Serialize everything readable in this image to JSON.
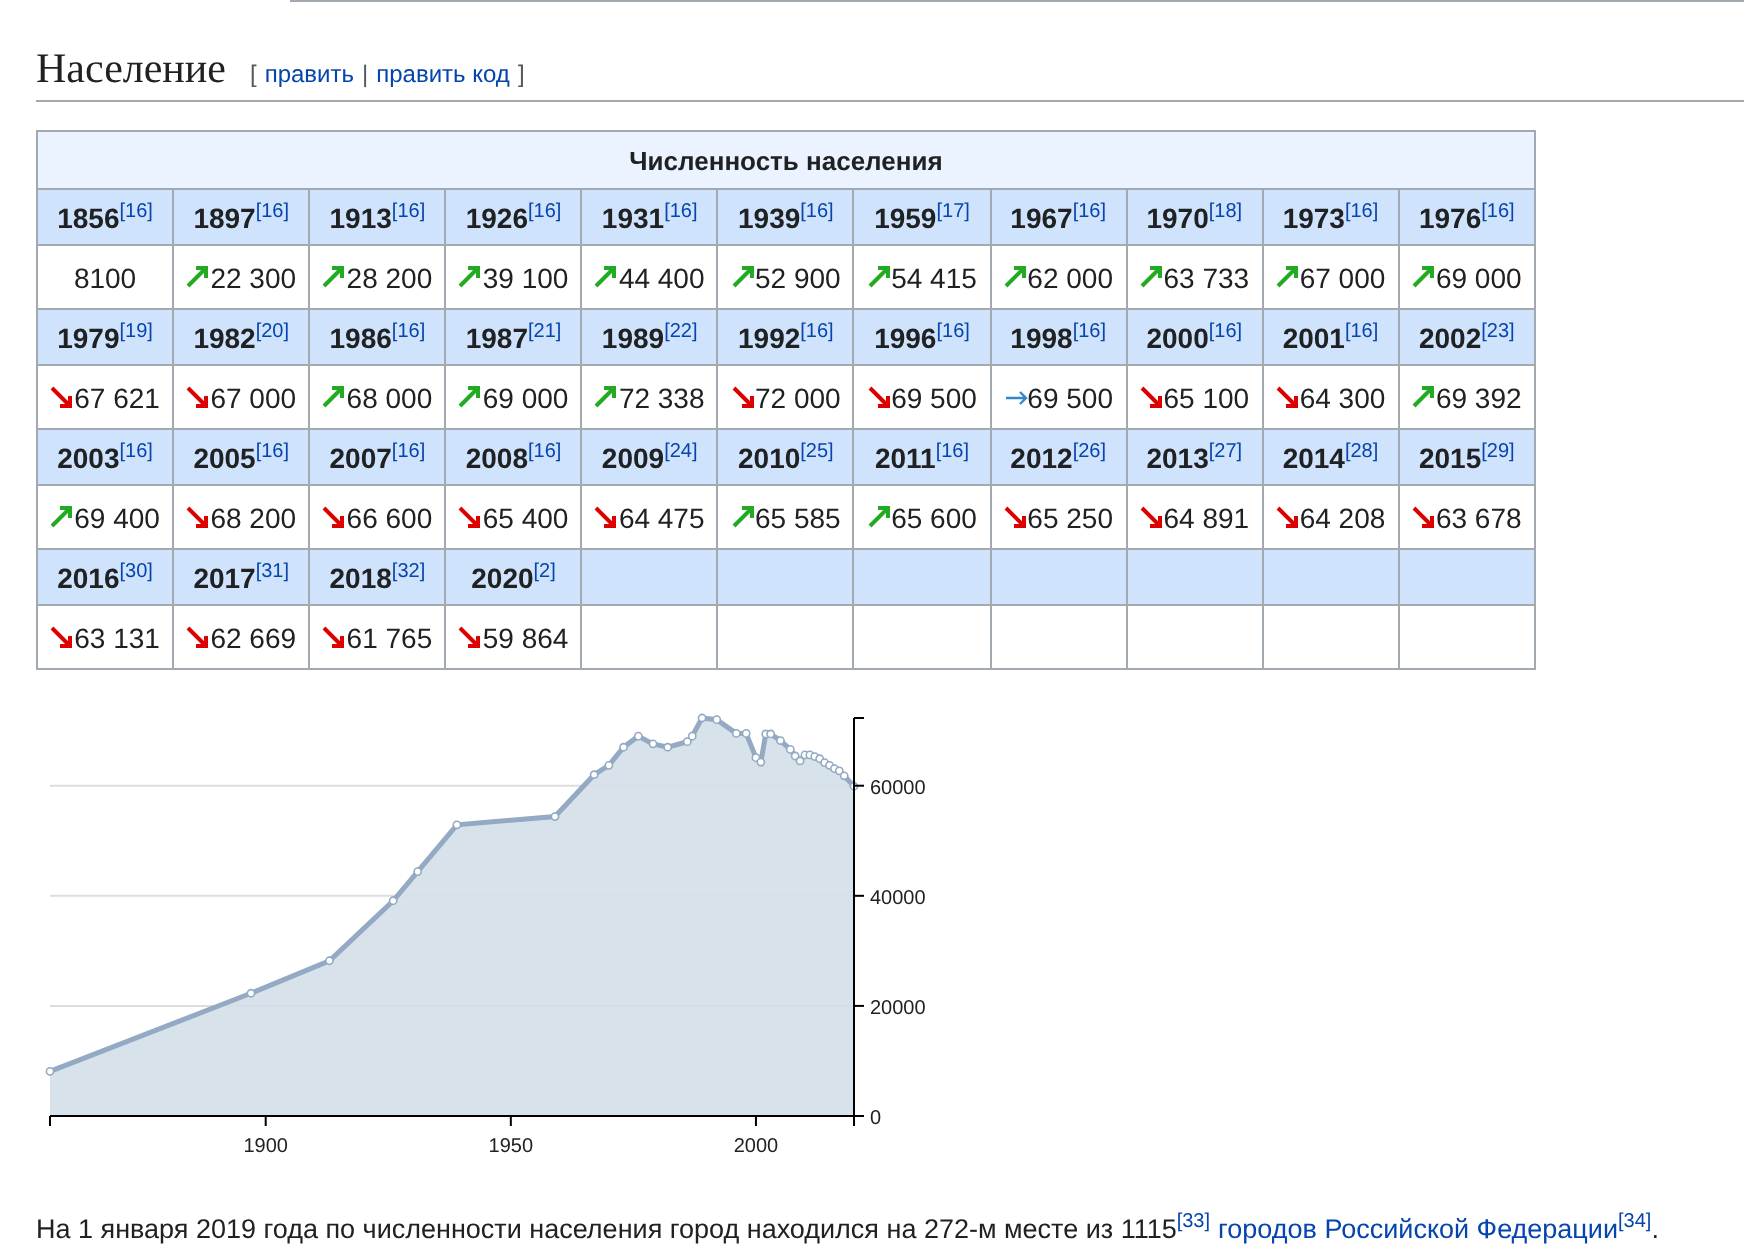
{
  "section": {
    "title": "Население",
    "edit_open": "[",
    "edit_links": [
      "править",
      "править код"
    ],
    "edit_separator": "|",
    "edit_close": "]"
  },
  "table": {
    "caption": "Численность населения",
    "rows": [
      {
        "kind": "years",
        "cells": [
          {
            "year": "1856",
            "ref": "[16]"
          },
          {
            "year": "1897",
            "ref": "[16]"
          },
          {
            "year": "1913",
            "ref": "[16]"
          },
          {
            "year": "1926",
            "ref": "[16]"
          },
          {
            "year": "1931",
            "ref": "[16]"
          },
          {
            "year": "1939",
            "ref": "[16]"
          },
          {
            "year": "1959",
            "ref": "[17]"
          },
          {
            "year": "1967",
            "ref": "[16]"
          },
          {
            "year": "1970",
            "ref": "[18]"
          },
          {
            "year": "1973",
            "ref": "[16]"
          },
          {
            "year": "1976",
            "ref": "[16]"
          }
        ]
      },
      {
        "kind": "values",
        "cells": [
          {
            "value": "8100"
          },
          {
            "value": "22 300",
            "kind": "up"
          },
          {
            "value": "28 200",
            "kind": "up"
          },
          {
            "value": "39 100",
            "kind": "up"
          },
          {
            "value": "44 400",
            "kind": "up"
          },
          {
            "value": "52 900",
            "kind": "up"
          },
          {
            "value": "54 415",
            "kind": "up"
          },
          {
            "value": "62 000",
            "kind": "up"
          },
          {
            "value": "63 733",
            "kind": "up"
          },
          {
            "value": "67 000",
            "kind": "up"
          },
          {
            "value": "69 000",
            "kind": "up"
          }
        ]
      },
      {
        "kind": "years",
        "cells": [
          {
            "year": "1979",
            "ref": "[19]"
          },
          {
            "year": "1982",
            "ref": "[20]"
          },
          {
            "year": "1986",
            "ref": "[16]"
          },
          {
            "year": "1987",
            "ref": "[21]"
          },
          {
            "year": "1989",
            "ref": "[22]"
          },
          {
            "year": "1992",
            "ref": "[16]"
          },
          {
            "year": "1996",
            "ref": "[16]"
          },
          {
            "year": "1998",
            "ref": "[16]"
          },
          {
            "year": "2000",
            "ref": "[16]"
          },
          {
            "year": "2001",
            "ref": "[16]"
          },
          {
            "year": "2002",
            "ref": "[23]"
          }
        ]
      },
      {
        "kind": "values",
        "cells": [
          {
            "value": "67 621",
            "kind": "down"
          },
          {
            "value": "67 000",
            "kind": "down"
          },
          {
            "value": "68 000",
            "kind": "up"
          },
          {
            "value": "69 000",
            "kind": "up"
          },
          {
            "value": "72 338",
            "kind": "up"
          },
          {
            "value": "72 000",
            "kind": "down"
          },
          {
            "value": "69 500",
            "kind": "down"
          },
          {
            "value": "69 500",
            "kind": "flat"
          },
          {
            "value": "65 100",
            "kind": "down"
          },
          {
            "value": "64 300",
            "kind": "down"
          },
          {
            "value": "69 392",
            "kind": "up"
          }
        ]
      },
      {
        "kind": "years",
        "cells": [
          {
            "year": "2003",
            "ref": "[16]"
          },
          {
            "year": "2005",
            "ref": "[16]"
          },
          {
            "year": "2007",
            "ref": "[16]"
          },
          {
            "year": "2008",
            "ref": "[16]"
          },
          {
            "year": "2009",
            "ref": "[24]"
          },
          {
            "year": "2010",
            "ref": "[25]"
          },
          {
            "year": "2011",
            "ref": "[16]"
          },
          {
            "year": "2012",
            "ref": "[26]"
          },
          {
            "year": "2013",
            "ref": "[27]"
          },
          {
            "year": "2014",
            "ref": "[28]"
          },
          {
            "year": "2015",
            "ref": "[29]"
          }
        ]
      },
      {
        "kind": "values",
        "cells": [
          {
            "value": "69 400",
            "kind": "up"
          },
          {
            "value": "68 200",
            "kind": "down"
          },
          {
            "value": "66 600",
            "kind": "down"
          },
          {
            "value": "65 400",
            "kind": "down"
          },
          {
            "value": "64 475",
            "kind": "down"
          },
          {
            "value": "65 585",
            "kind": "up"
          },
          {
            "value": "65 600",
            "kind": "up"
          },
          {
            "value": "65 250",
            "kind": "down"
          },
          {
            "value": "64 891",
            "kind": "down"
          },
          {
            "value": "64 208",
            "kind": "down"
          },
          {
            "value": "63 678",
            "kind": "down"
          }
        ]
      },
      {
        "kind": "years",
        "cells": [
          {
            "year": "2016",
            "ref": "[30]"
          },
          {
            "year": "2017",
            "ref": "[31]"
          },
          {
            "year": "2018",
            "ref": "[32]"
          },
          {
            "year": "2020",
            "ref": "[2]"
          }
        ]
      },
      {
        "kind": "values",
        "cells": [
          {
            "value": "63 131",
            "kind": "down"
          },
          {
            "value": "62 669",
            "kind": "down"
          },
          {
            "value": "61 765",
            "kind": "down"
          },
          {
            "value": "59 864",
            "kind": "down"
          }
        ]
      }
    ]
  },
  "chart": {
    "chart_data": {
      "type": "area",
      "x": [
        1856,
        1897,
        1913,
        1926,
        1931,
        1939,
        1959,
        1967,
        1970,
        1973,
        1976,
        1979,
        1982,
        1986,
        1987,
        1989,
        1992,
        1996,
        1998,
        2000,
        2001,
        2002,
        2003,
        2005,
        2007,
        2008,
        2009,
        2010,
        2011,
        2012,
        2013,
        2014,
        2015,
        2016,
        2017,
        2018,
        2020
      ],
      "values": [
        8100,
        22300,
        28200,
        39100,
        44400,
        52900,
        54400,
        62000,
        63700,
        67000,
        69000,
        67600,
        67000,
        68000,
        69000,
        72300,
        72000,
        69500,
        69500,
        65100,
        64300,
        69400,
        69400,
        68200,
        66600,
        65400,
        64500,
        65600,
        65600,
        65300,
        64900,
        64200,
        63700,
        63100,
        62700,
        61800,
        59900
      ],
      "xlim": [
        1856,
        2020
      ],
      "ylim": [
        0,
        72300
      ],
      "grid": true,
      "xticks": [
        1900,
        1950,
        2000
      ],
      "yticks": [
        0,
        20000,
        40000,
        60000
      ]
    }
  },
  "paragraph": [
    {
      "kind": "text",
      "text": "На 1 января 2019 года по численности населения город находился на 272-м месте из 1115"
    },
    {
      "kind": "ref",
      "text": "[33]"
    },
    {
      "kind": "link",
      "text": "городов Российской Федерации"
    },
    {
      "kind": "ref",
      "text": "[34]"
    },
    {
      "kind": "text",
      "text": "."
    }
  ]
}
